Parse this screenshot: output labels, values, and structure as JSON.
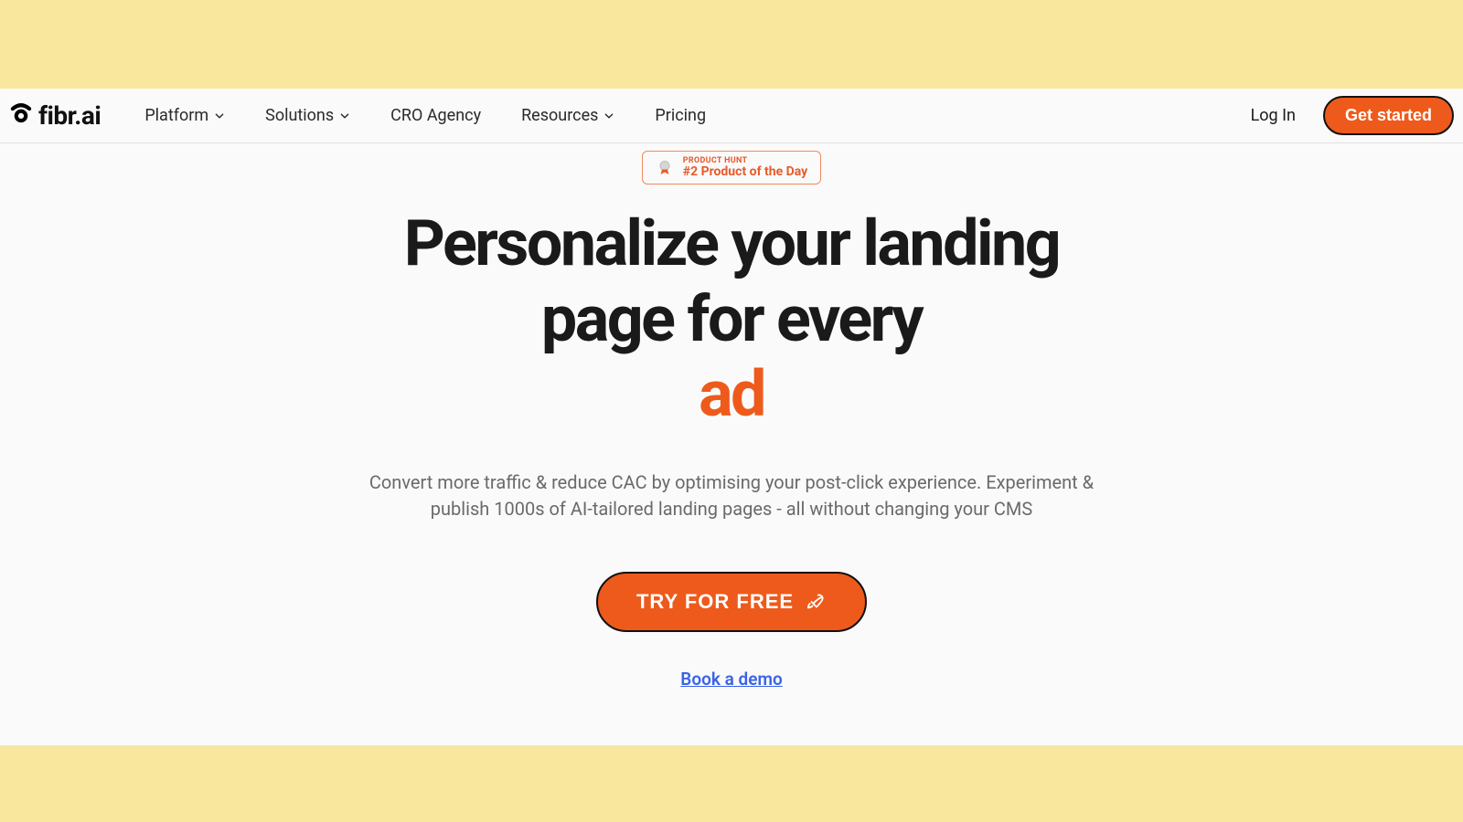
{
  "brand": {
    "name": "fibr.ai"
  },
  "nav": {
    "items": [
      {
        "label": "Platform",
        "has_dropdown": true
      },
      {
        "label": "Solutions",
        "has_dropdown": true
      },
      {
        "label": "CRO Agency",
        "has_dropdown": false
      },
      {
        "label": "Resources",
        "has_dropdown": true
      },
      {
        "label": "Pricing",
        "has_dropdown": false
      }
    ],
    "login": "Log In",
    "cta": "Get started"
  },
  "badge": {
    "top": "PRODUCT HUNT",
    "main": "#2 Product of the Day"
  },
  "hero": {
    "headline_a": "Personalize your landing",
    "headline_b": "page for every",
    "headline_accent": "ad",
    "sub": "Convert more traffic & reduce CAC by optimising your post-click experience. Experiment & publish 1000s of AI-tailored landing pages - all without changing your CMS",
    "cta": "TRY FOR FREE",
    "demo": "Book a demo"
  },
  "colors": {
    "accent": "#ee5a1b",
    "link": "#3a63e8",
    "frame_bg": "#f8e79c"
  }
}
